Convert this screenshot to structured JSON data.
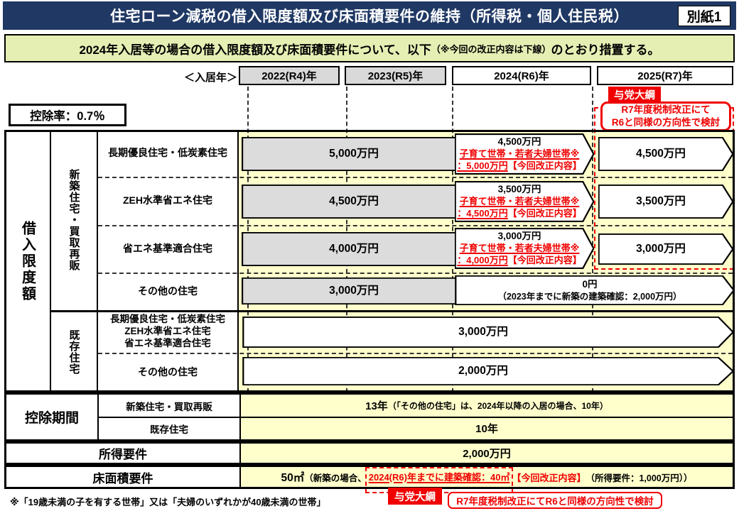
{
  "colors": {
    "navy": "#1f3864",
    "red": "#f00000",
    "body_yellow": "#ffffcc",
    "subtitle_green": "#e5efb4",
    "gray": "#d9d9d9"
  },
  "title": {
    "text": "住宅ローン減税の借入限度額及び床面積要件の維持（所得税・個人住民税）",
    "badge": "別紙1"
  },
  "subtitle": {
    "pre": "2024年入居等の場合の借入限度額及び床面積要件について、以下",
    "paren": "（※今回の改正内容は下線）",
    "post": "のとおり措置する。"
  },
  "header": {
    "label": "＜入居年＞",
    "y2022": "2022(R4)年",
    "y2023": "2023(R5)年",
    "y2024": "2024(R6)年",
    "y2025": "2025(R7)年"
  },
  "deduction_rate": "控除率：0.7％",
  "ruling_party_top": {
    "badge": "与党大綱",
    "line1": "R7年度税制改正にて",
    "line2": "R6と同様の方向性で検討"
  },
  "loan_limit": {
    "axis_label": "借入限度額",
    "new_group_label": "新築住宅・買取再販",
    "existing_group_label": "既存住宅",
    "rows": {
      "r1": {
        "label": "長期優良住宅・低炭素住宅",
        "v2022_23": "5,000万円",
        "v2024_base": "4,500万円",
        "v2024_red1": "子育て世帯・若者夫婦世帯※",
        "v2024_red2": "：5,000万円",
        "v2024_red3": "【今回改正内容】",
        "v2025": "4,500万円"
      },
      "r2": {
        "label": "ZEH水準省エネ住宅",
        "v2022_23": "4,500万円",
        "v2024_base": "3,500万円",
        "v2024_red1": "子育て世帯・若者夫婦世帯※",
        "v2024_red2": "：4,500万円",
        "v2024_red3": "【今回改正内容】",
        "v2025": "3,500万円"
      },
      "r3": {
        "label": "省エネ基準適合住宅",
        "v2022_23": "4,000万円",
        "v2024_base": "3,000万円",
        "v2024_red1": "子育て世帯・若者夫婦世帯※",
        "v2024_red2": "：4,000万円",
        "v2024_red3": "【今回改正内容】",
        "v2025": "3,000万円"
      },
      "r4": {
        "label": "その他の住宅",
        "v2022_23": "3,000万円",
        "v2024_25_line1": "0円",
        "v2024_25_line2": "（2023年までに新築の建築確認：2,000万円）"
      },
      "r5": {
        "label_line1": "長期優良住宅・低炭素住宅",
        "label_line2": "ZEH水準省エネ住宅",
        "label_line3": "省エネ基準適合住宅",
        "value": "3,000万円"
      },
      "r6": {
        "label": "その他の住宅",
        "value": "2,000万円"
      }
    }
  },
  "deduction_period": {
    "label": "控除期間",
    "row1_label": "新築住宅・買取再販",
    "row1_value_main": "13年",
    "row1_value_note": "（「その他の住宅」は、2024年以降の入居の場合、10年）",
    "row2_label": "既存住宅",
    "row2_value": "10年"
  },
  "income_req": {
    "label": "所得要件",
    "value": "2,000万円"
  },
  "floor_req": {
    "label": "床面積要件",
    "value_main": "50㎡",
    "value_pre": "（新築の場合、",
    "value_red_boxed": "2024(R6)年までに建築確認：40㎡",
    "value_red_tag": "【今回改正内容】",
    "value_post": "（所得要件：1,000万円））"
  },
  "footnote": "※「19歳未満の子を有する世帯」又は「夫婦のいずれかが40歳未満の世帯」",
  "ruling_party_bottom": {
    "badge": "与党大綱",
    "note": "R7年度税制改正にてR6と同様の方向性で検討"
  }
}
